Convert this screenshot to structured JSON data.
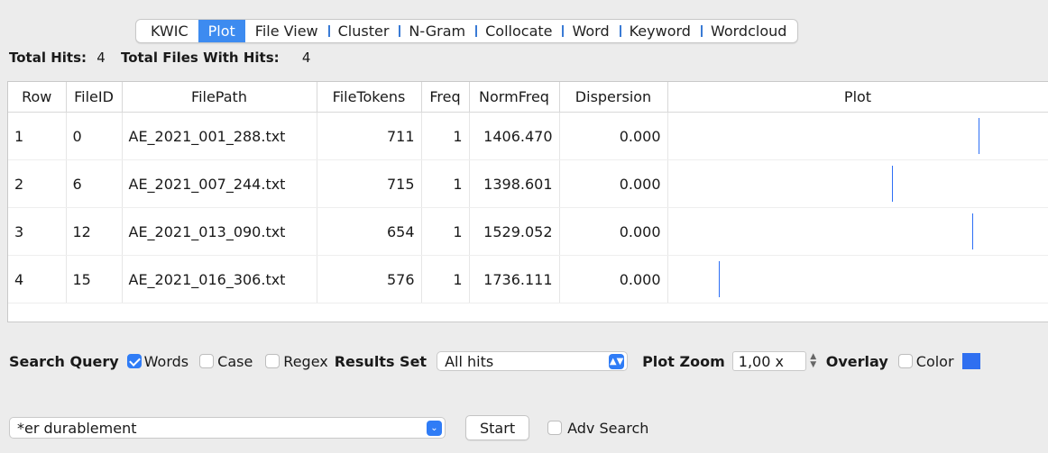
{
  "tabs": [
    "KWIC",
    "Plot",
    "File View",
    "Cluster",
    "N-Gram",
    "Collocate",
    "Word",
    "Keyword",
    "Wordcloud"
  ],
  "active_tab": "Plot",
  "totals": {
    "hits_label": "Total Hits:",
    "hits_value": "4",
    "files_label": "Total Files With Hits:",
    "files_value": "4"
  },
  "table": {
    "headers": [
      "Row",
      "FileID",
      "FilePath",
      "FileTokens",
      "Freq",
      "NormFreq",
      "Dispersion",
      "Plot"
    ],
    "rows": [
      {
        "row": "1",
        "fileid": "0",
        "filepath": "AE_2021_001_288.txt",
        "tokens": "711",
        "freq": "1",
        "normfreq": "1406.470",
        "dispersion": "0.000",
        "plot_position": 0.818
      },
      {
        "row": "2",
        "fileid": "6",
        "filepath": "AE_2021_007_244.txt",
        "tokens": "715",
        "freq": "1",
        "normfreq": "1398.601",
        "dispersion": "0.000",
        "plot_position": 0.59
      },
      {
        "row": "3",
        "fileid": "12",
        "filepath": "AE_2021_013_090.txt",
        "tokens": "654",
        "freq": "1",
        "normfreq": "1529.052",
        "dispersion": "0.000",
        "plot_position": 0.8
      },
      {
        "row": "4",
        "fileid": "15",
        "filepath": "AE_2021_016_306.txt",
        "tokens": "576",
        "freq": "1",
        "normfreq": "1736.111",
        "dispersion": "0.000",
        "plot_position": 0.135
      }
    ],
    "plot_line_color": "#2d6ff5"
  },
  "controls": {
    "search_query_label": "Search Query",
    "words_label": "Words",
    "words_checked": true,
    "case_label": "Case",
    "case_checked": false,
    "regex_label": "Regex",
    "regex_checked": false,
    "results_set_label": "Results Set",
    "results_set_value": "All hits",
    "plot_zoom_label": "Plot Zoom",
    "plot_zoom_value": "1,00 x",
    "overlay_label": "Overlay",
    "color_label": "Color",
    "overlay_color": "#2f6ff0"
  },
  "query": {
    "value": "*er durablement",
    "start_label": "Start",
    "adv_search_label": "Adv Search",
    "adv_search_checked": false
  },
  "colors": {
    "accent": "#3d8bf0",
    "background": "#ececec"
  }
}
